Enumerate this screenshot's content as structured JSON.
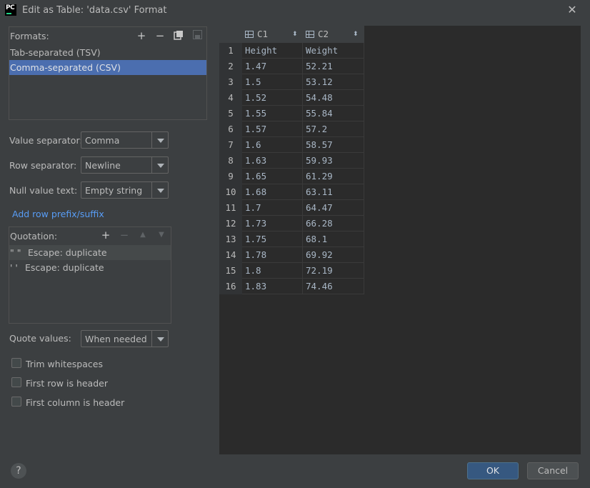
{
  "window": {
    "title": "Edit as Table: 'data.csv' Format"
  },
  "formats": {
    "header": "Formats:",
    "items": [
      "Tab-separated (TSV)",
      "Comma-separated (CSV)"
    ],
    "selected_index": 1
  },
  "settings": {
    "value_separator": {
      "label": "Value separator:",
      "value": "Comma"
    },
    "row_separator": {
      "label": "Row separator:",
      "value": "Newline"
    },
    "null_value": {
      "label": "Null value text:",
      "value": "Empty string"
    },
    "add_prefix_link": "Add row prefix/suffix"
  },
  "quotation": {
    "header": "Quotation:",
    "rows": [
      {
        "quote": "\" \"",
        "escape": "Escape: duplicate"
      },
      {
        "quote": "' '",
        "escape": "Escape: duplicate"
      }
    ]
  },
  "quote_values": {
    "label": "Quote values:",
    "value": "When needed"
  },
  "checkboxes": {
    "trim": {
      "label": "Trim whitespaces",
      "checked": false
    },
    "first_row_header": {
      "label": "First row is header",
      "checked": false
    },
    "first_col_header": {
      "label": "First column is header",
      "checked": false
    }
  },
  "table": {
    "columns": [
      "C1",
      "C2"
    ],
    "rows": [
      [
        "1",
        "Height",
        "Weight"
      ],
      [
        "2",
        "1.47",
        "52.21"
      ],
      [
        "3",
        "1.5",
        "53.12"
      ],
      [
        "4",
        "1.52",
        "54.48"
      ],
      [
        "5",
        "1.55",
        "55.84"
      ],
      [
        "6",
        "1.57",
        "57.2"
      ],
      [
        "7",
        "1.6",
        "58.57"
      ],
      [
        "8",
        "1.63",
        "59.93"
      ],
      [
        "9",
        "1.65",
        "61.29"
      ],
      [
        "10",
        "1.68",
        "63.11"
      ],
      [
        "11",
        "1.7",
        "64.47"
      ],
      [
        "12",
        "1.73",
        "66.28"
      ],
      [
        "13",
        "1.75",
        "68.1"
      ],
      [
        "14",
        "1.78",
        "69.92"
      ],
      [
        "15",
        "1.8",
        "72.19"
      ],
      [
        "16",
        "1.83",
        "74.46"
      ]
    ]
  },
  "buttons": {
    "ok": "OK",
    "cancel": "Cancel",
    "help": "?"
  },
  "colors": {
    "selection": "#4b6eaf",
    "link": "#589df6",
    "ok_button": "#365880"
  }
}
